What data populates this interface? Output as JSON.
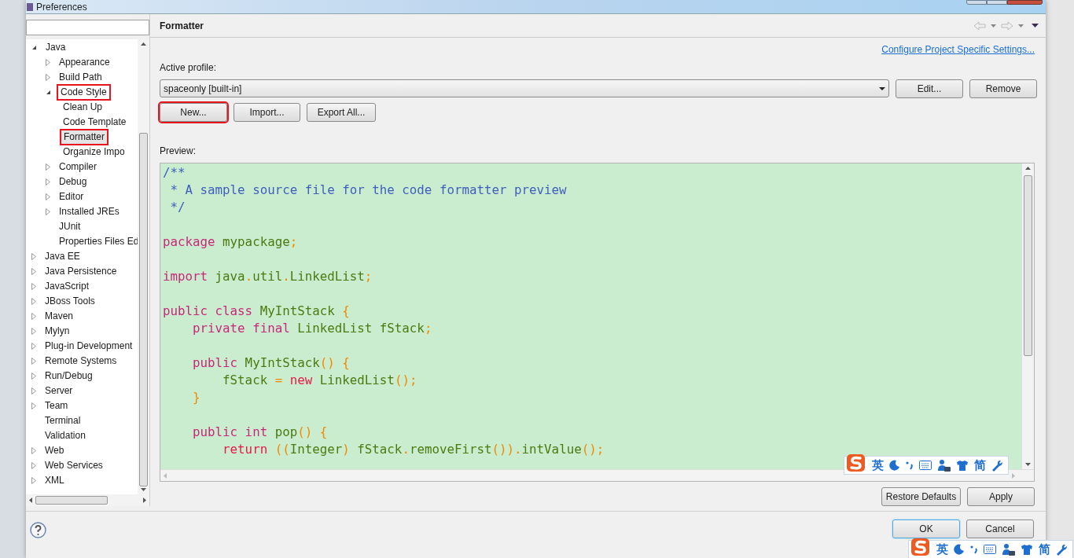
{
  "window": {
    "title": "Preferences"
  },
  "tree": [
    {
      "label": "Java",
      "expanded": true,
      "selected": false,
      "annotated": false,
      "children": [
        {
          "label": "Appearance",
          "expanded": false,
          "selected": false,
          "annotated": false
        },
        {
          "label": "Build Path",
          "expanded": false,
          "selected": false,
          "annotated": false
        },
        {
          "label": "Code Style",
          "expanded": true,
          "selected": false,
          "annotated": true,
          "children": [
            {
              "label": "Clean Up",
              "selected": false,
              "annotated": false
            },
            {
              "label": "Code Template",
              "selected": false,
              "annotated": false
            },
            {
              "label": "Formatter",
              "selected": true,
              "annotated": true
            },
            {
              "label": "Organize Impo",
              "selected": false,
              "annotated": false
            }
          ]
        },
        {
          "label": "Compiler",
          "expanded": false,
          "selected": false,
          "annotated": false
        },
        {
          "label": "Debug",
          "expanded": false,
          "selected": false,
          "annotated": false
        },
        {
          "label": "Editor",
          "expanded": false,
          "selected": false,
          "annotated": false
        },
        {
          "label": "Installed JREs",
          "expanded": false,
          "selected": false,
          "annotated": false
        },
        {
          "label": "JUnit",
          "selected": false,
          "annotated": false
        },
        {
          "label": "Properties Files Ed",
          "selected": false,
          "annotated": false
        }
      ]
    },
    {
      "label": "Java EE",
      "expanded": false,
      "selected": false,
      "annotated": false
    },
    {
      "label": "Java Persistence",
      "expanded": false,
      "selected": false,
      "annotated": false
    },
    {
      "label": "JavaScript",
      "expanded": false,
      "selected": false,
      "annotated": false
    },
    {
      "label": "JBoss Tools",
      "expanded": false,
      "selected": false,
      "annotated": false
    },
    {
      "label": "Maven",
      "expanded": false,
      "selected": false,
      "annotated": false
    },
    {
      "label": "Mylyn",
      "expanded": false,
      "selected": false,
      "annotated": false
    },
    {
      "label": "Plug-in Development",
      "expanded": false,
      "selected": false,
      "annotated": false
    },
    {
      "label": "Remote Systems",
      "expanded": false,
      "selected": false,
      "annotated": false
    },
    {
      "label": "Run/Debug",
      "expanded": false,
      "selected": false,
      "annotated": false
    },
    {
      "label": "Server",
      "expanded": false,
      "selected": false,
      "annotated": false
    },
    {
      "label": "Team",
      "expanded": false,
      "selected": false,
      "annotated": false
    },
    {
      "label": "Terminal",
      "selected": false,
      "annotated": false
    },
    {
      "label": "Validation",
      "selected": false,
      "annotated": false
    },
    {
      "label": "Web",
      "expanded": false,
      "selected": false,
      "annotated": false
    },
    {
      "label": "Web Services",
      "expanded": false,
      "selected": false,
      "annotated": false
    },
    {
      "label": "XML",
      "expanded": false,
      "selected": false,
      "annotated": false
    }
  ],
  "page": {
    "title": "Formatter",
    "link": "Configure Project Specific Settings...",
    "profile_label": "Active profile:",
    "profile_value": "spaceonly [built-in]",
    "profile_buttons": [
      "Edit...",
      "Remove"
    ],
    "actions": [
      {
        "label": "New...",
        "annotated": true
      },
      {
        "label": "Import...",
        "annotated": false
      },
      {
        "label": "Export All...",
        "annotated": false
      }
    ],
    "preview_label": "Preview:",
    "code": [
      {
        "kind": "code",
        "tokens": [
          {
            "text": "/**",
            "kind": "comment"
          }
        ]
      },
      {
        "kind": "code",
        "tokens": [
          {
            "text": " * A sample source file for the code formatter preview",
            "kind": "comment"
          }
        ]
      },
      {
        "kind": "code",
        "tokens": [
          {
            "text": " */",
            "kind": "comment"
          }
        ]
      },
      {
        "kind": "blank"
      },
      {
        "kind": "code",
        "tokens": [
          {
            "text": "package",
            "kind": "keyword"
          },
          {
            "text": " mypackage",
            "kind": "ident"
          },
          {
            "text": ";",
            "kind": "punct"
          }
        ]
      },
      {
        "kind": "blank"
      },
      {
        "kind": "code",
        "tokens": [
          {
            "text": "import",
            "kind": "keyword"
          },
          {
            "text": " java",
            "kind": "ident"
          },
          {
            "text": ".",
            "kind": "punct"
          },
          {
            "text": "util",
            "kind": "ident"
          },
          {
            "text": ".",
            "kind": "punct"
          },
          {
            "text": "LinkedList",
            "kind": "ident"
          },
          {
            "text": ";",
            "kind": "punct"
          }
        ]
      },
      {
        "kind": "blank"
      },
      {
        "kind": "code",
        "tokens": [
          {
            "text": "public class",
            "kind": "keyword"
          },
          {
            "text": " MyIntStack ",
            "kind": "ident"
          },
          {
            "text": "{",
            "kind": "punct"
          }
        ]
      },
      {
        "kind": "code",
        "tokens": [
          {
            "text": "    private final",
            "kind": "keyword"
          },
          {
            "text": " LinkedList fStack",
            "kind": "ident"
          },
          {
            "text": ";",
            "kind": "punct"
          }
        ]
      },
      {
        "kind": "blank"
      },
      {
        "kind": "code",
        "tokens": [
          {
            "text": "    public",
            "kind": "keyword"
          },
          {
            "text": " MyIntStack",
            "kind": "ident"
          },
          {
            "text": "() {",
            "kind": "punct"
          }
        ]
      },
      {
        "kind": "code",
        "tokens": [
          {
            "text": "        fStack ",
            "kind": "ident"
          },
          {
            "text": "= ",
            "kind": "punct"
          },
          {
            "text": "new",
            "kind": "return"
          },
          {
            "text": " LinkedList",
            "kind": "ident"
          },
          {
            "text": "();",
            "kind": "punct"
          }
        ]
      },
      {
        "kind": "code",
        "tokens": [
          {
            "text": "    }",
            "kind": "punct"
          }
        ]
      },
      {
        "kind": "blank"
      },
      {
        "kind": "code",
        "tokens": [
          {
            "text": "    public int",
            "kind": "keyword"
          },
          {
            "text": " pop",
            "kind": "ident"
          },
          {
            "text": "() {",
            "kind": "punct"
          }
        ]
      },
      {
        "kind": "code",
        "tokens": [
          {
            "text": "        return",
            "kind": "return"
          },
          {
            "text": " ((",
            "kind": "punct"
          },
          {
            "text": "Integer",
            "kind": "ident"
          },
          {
            "text": ") ",
            "kind": "punct"
          },
          {
            "text": "fStack",
            "kind": "ident"
          },
          {
            "text": ".",
            "kind": "punct"
          },
          {
            "text": "removeFirst",
            "kind": "ident"
          },
          {
            "text": "()).",
            "kind": "punct"
          },
          {
            "text": "intValue",
            "kind": "ident"
          },
          {
            "text": "();",
            "kind": "punct"
          }
        ]
      }
    ],
    "page_buttons": [
      "Restore Defaults",
      "Apply"
    ]
  },
  "dialog_buttons": [
    {
      "label": "OK",
      "default": true
    },
    {
      "label": "Cancel",
      "default": false
    }
  ],
  "ime_bars": [
    {
      "mode": "英",
      "script": "简"
    },
    {
      "mode": "英",
      "script": "简"
    }
  ]
}
